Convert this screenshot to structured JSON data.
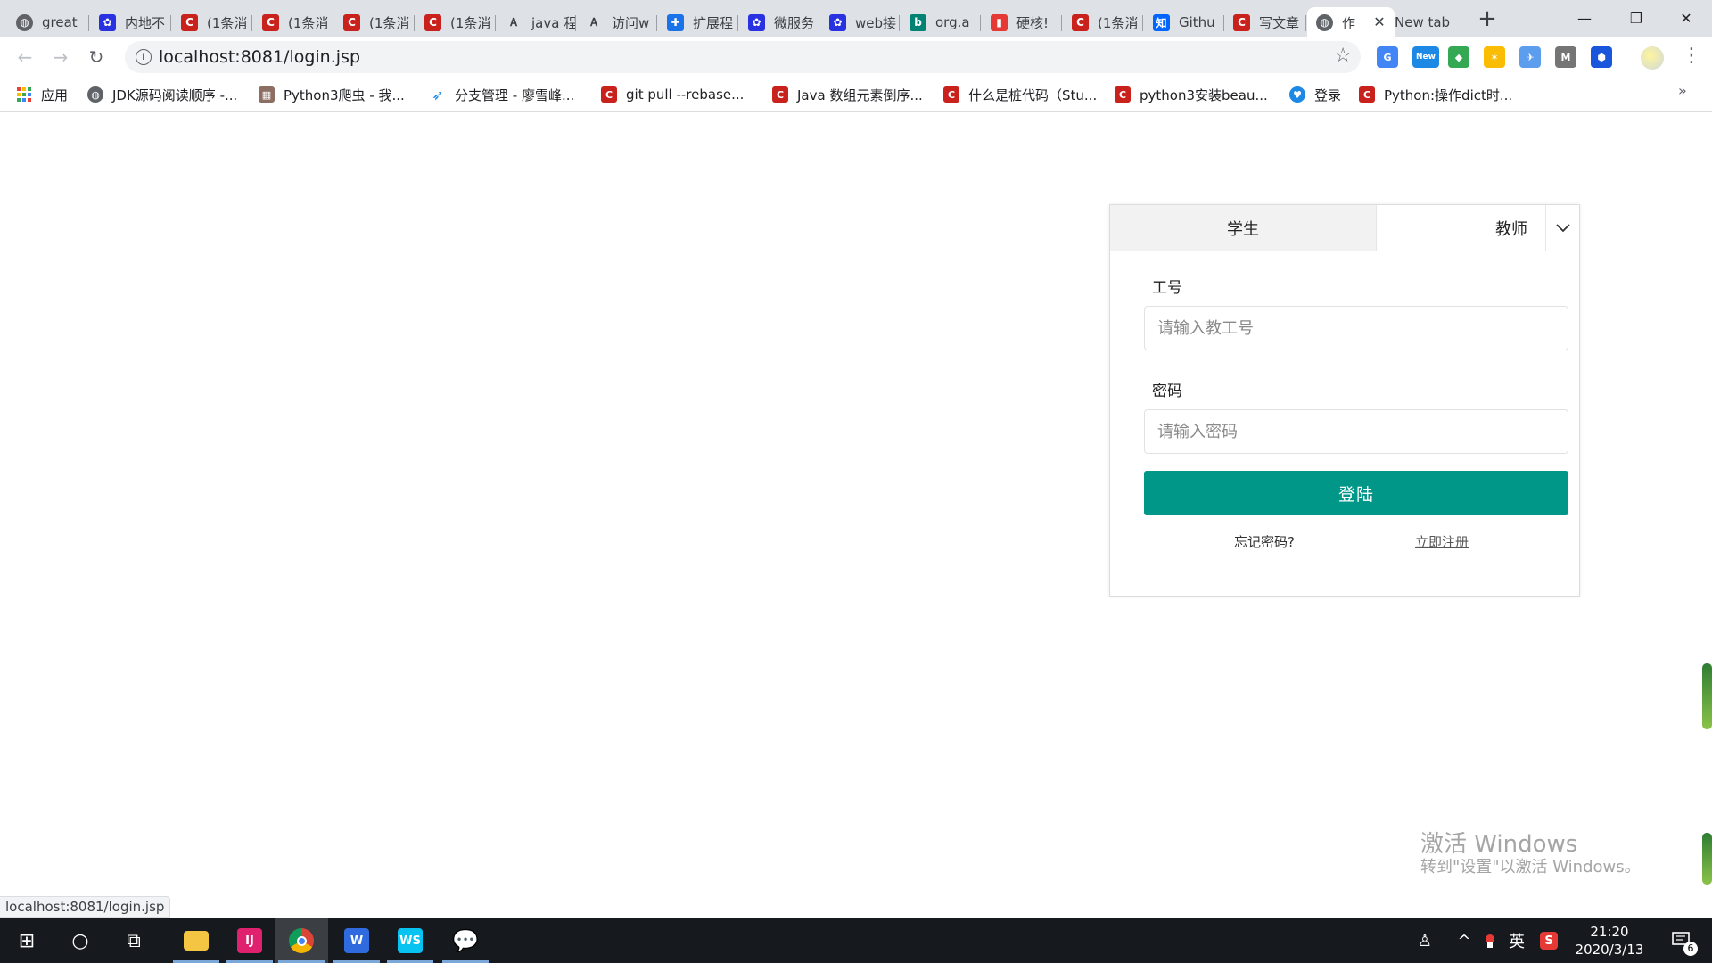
{
  "browser": {
    "tabs": [
      {
        "title": "great",
        "favicon": "globe-icon",
        "color": "#5f6368"
      },
      {
        "title": "内地不",
        "favicon": "baidu-paw-icon",
        "color": "#2932e1"
      },
      {
        "title": "(1条消",
        "favicon": "csdn-icon",
        "color": "#c9221d"
      },
      {
        "title": "(1条消",
        "favicon": "csdn-icon",
        "color": "#c9221d"
      },
      {
        "title": "(1条消",
        "favicon": "csdn-icon",
        "color": "#c9221d"
      },
      {
        "title": "(1条消",
        "favicon": "csdn-icon",
        "color": "#c9221d"
      },
      {
        "title": "java 程",
        "favicon": "translate-icon",
        "color": "#3c4043"
      },
      {
        "title": "访问w",
        "favicon": "translate-icon",
        "color": "#3c4043"
      },
      {
        "title": "扩展程",
        "favicon": "puzzle-icon",
        "color": "#1a73e8"
      },
      {
        "title": "微服务",
        "favicon": "baidu-paw-icon",
        "color": "#2932e1"
      },
      {
        "title": "web接",
        "favicon": "baidu-paw-icon",
        "color": "#2932e1"
      },
      {
        "title": "org.a",
        "favicon": "bing-icon",
        "color": "#008373"
      },
      {
        "title": "硬核!",
        "favicon": "colorful-icon",
        "color": "#e53935"
      },
      {
        "title": "(1条消",
        "favicon": "csdn-icon",
        "color": "#c9221d"
      },
      {
        "title": "Githu",
        "favicon": "zhihu-icon",
        "color": "#0066ff"
      },
      {
        "title": "写文章",
        "favicon": "csdn-icon",
        "color": "#c9221d"
      },
      {
        "title": "作",
        "favicon": "globe-icon",
        "color": "#5f6368",
        "active": true
      },
      {
        "title": "New tab",
        "favicon": "",
        "color": ""
      }
    ],
    "new_tab_symbol": "+",
    "window_controls": {
      "minimize": "—",
      "maximize": "❐",
      "close": "✕"
    },
    "tab_close_symbol": "✕",
    "nav": {
      "back": "←",
      "forward": "→",
      "reload": "↻"
    },
    "address": "localhost:8081/login.jsp",
    "info_symbol": "i",
    "star_symbol": "☆",
    "menu_symbol": "⋮",
    "extensions": [
      {
        "name": "translate-ext-icon",
        "color": "#4285f4",
        "label": "G"
      },
      {
        "name": "new-badge-ext-icon",
        "color": "#1e88e5",
        "label": "New"
      },
      {
        "name": "chrome-web-ext-icon",
        "color": "#34a853",
        "label": "◆"
      },
      {
        "name": "pinwheel-ext-icon",
        "color": "#fbbc04",
        "label": "✶"
      },
      {
        "name": "bird-ext-icon",
        "color": "#5c9ded",
        "label": "✈"
      },
      {
        "name": "mail-ext-icon",
        "color": "#757575",
        "label": "M"
      },
      {
        "name": "shield-ext-icon",
        "color": "#1a56db",
        "label": "⬢"
      },
      {
        "name": "profile-avatar-icon",
        "color": "#e0e0e0",
        "label": ""
      }
    ],
    "bookmarks": [
      {
        "label": "应用",
        "icon": "apps-grid-icon",
        "color": "#ea4335"
      },
      {
        "label": "JDK源码阅读顺序 -...",
        "icon": "globe-icon",
        "color": "#5f6368"
      },
      {
        "label": "Python3爬虫 - 我...",
        "icon": "bookmark-image-icon",
        "color": "#8d6e63"
      },
      {
        "label": "分支管理 - 廖雪峰...",
        "icon": "rocket-icon",
        "color": "#1e88e5"
      },
      {
        "label": "git pull --rebase...",
        "icon": "csdn-icon",
        "color": "#c9221d"
      },
      {
        "label": "Java 数组元素倒序...",
        "icon": "csdn-icon",
        "color": "#c9221d"
      },
      {
        "label": "什么是桩代码（Stu...",
        "icon": "csdn-icon",
        "color": "#c9221d"
      },
      {
        "label": "python3安装beau...",
        "icon": "csdn-icon",
        "color": "#c9221d"
      },
      {
        "label": "登录",
        "icon": "heart-shield-icon",
        "color": "#1e88e5"
      },
      {
        "label": "Python:操作dict时...",
        "icon": "csdn-icon",
        "color": "#c9221d"
      }
    ],
    "bookmarks_overflow": "»",
    "status_url": "localhost:8081/login.jsp"
  },
  "login": {
    "tabs": {
      "student": "学生",
      "teacher": "教师"
    },
    "id_label": "工号",
    "id_placeholder": "请输入教工号",
    "password_label": "密码",
    "password_placeholder": "请输入密码",
    "submit": "登陆",
    "forgot": "忘记密码?",
    "register": "立即注册",
    "accent_color": "#009688"
  },
  "watermark": {
    "line1": "激活 Windows",
    "line2": "转到\"设置\"以激活 Windows。"
  },
  "taskbar": {
    "apps": [
      {
        "name": "start-windows-icon",
        "label": "⊞"
      },
      {
        "name": "cortana-search-icon",
        "label": "○"
      },
      {
        "name": "task-view-icon",
        "label": "⧉"
      },
      {
        "name": "file-explorer-icon",
        "label": "",
        "color": "#f4c542"
      },
      {
        "name": "intellij-idea-icon",
        "label": "IJ",
        "color": "#e0226e"
      },
      {
        "name": "chrome-icon",
        "label": "●",
        "color": "#db4437"
      },
      {
        "name": "wps-writer-icon",
        "label": "W",
        "color": "#2f6bde"
      },
      {
        "name": "webstorm-icon",
        "label": "WS",
        "color": "#07c3f2"
      },
      {
        "name": "wechat-icon",
        "label": "💬",
        "color": "#09bb07"
      }
    ],
    "tray": {
      "people": "♙",
      "chevron": "^",
      "ime": "英",
      "sogou": "S",
      "notifications_count": "6"
    },
    "time": "21:20",
    "date": "2020/3/13"
  }
}
